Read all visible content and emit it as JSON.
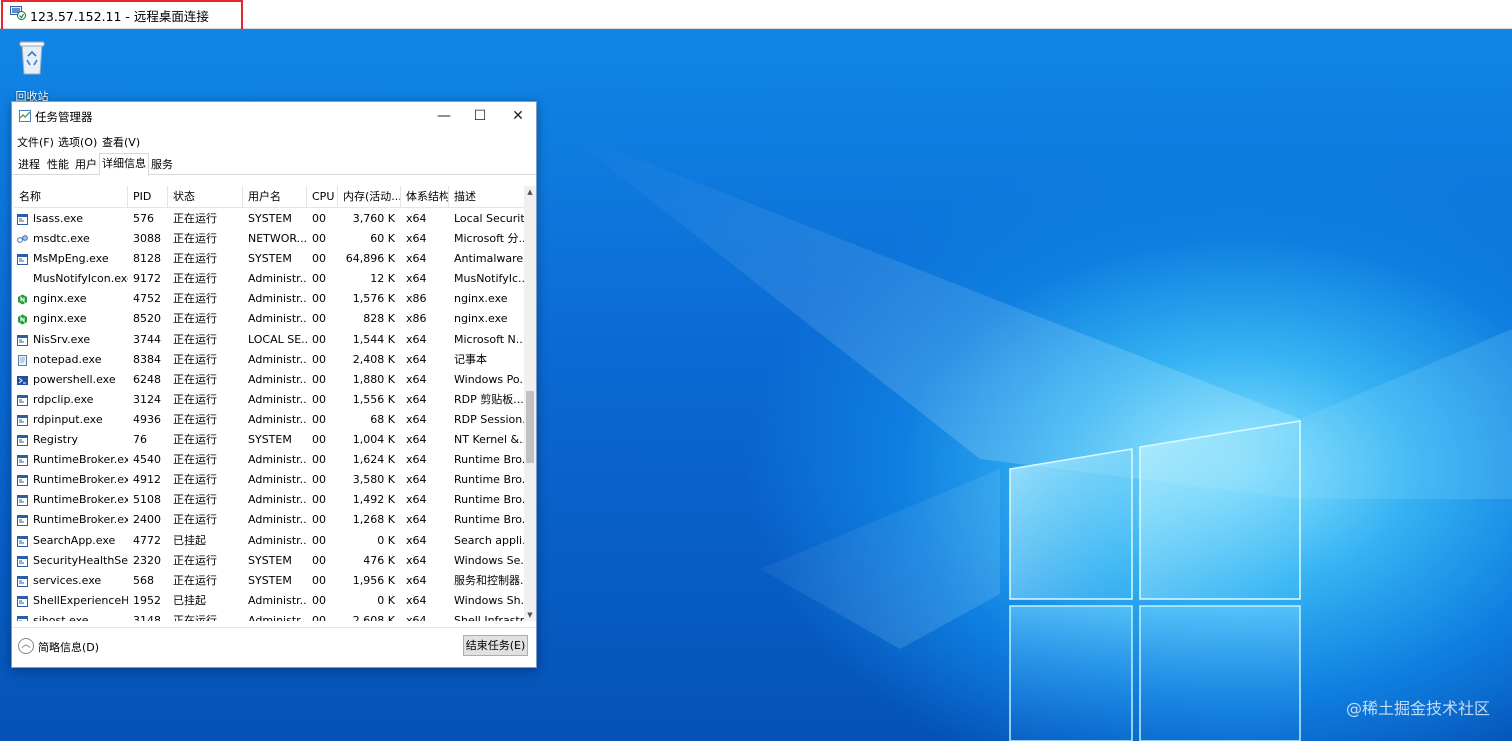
{
  "rdp": {
    "title": "123.57.152.11 - 远程桌面连接",
    "icon": "remote-desktop-icon",
    "highlight_color": "#e5262b"
  },
  "desktop": {
    "recycle_bin_label": "回收站",
    "watermark": "@稀土掘金技术社区",
    "background_color": "#0a5cc8"
  },
  "taskmgr": {
    "title": "任务管理器",
    "menu": [
      "文件(F)",
      "选项(O)",
      "查看(V)"
    ],
    "tabs": [
      "进程",
      "性能",
      "用户",
      "详细信息",
      "服务"
    ],
    "active_tab": "详细信息",
    "columns": [
      "名称",
      "PID",
      "状态",
      "用户名",
      "CPU",
      "内存(活动...",
      "体系结构",
      "描述"
    ],
    "rows": [
      {
        "name": "lsass.exe",
        "pid": "576",
        "status": "正在运行",
        "user": "SYSTEM",
        "cpu": "00",
        "mem": "3,760 K",
        "arch": "x64",
        "desc": "Local Securit...",
        "icon": "app-window-icon"
      },
      {
        "name": "msdtc.exe",
        "pid": "3088",
        "status": "正在运行",
        "user": "NETWOR...",
        "cpu": "00",
        "mem": "60 K",
        "arch": "x64",
        "desc": "Microsoft 分...",
        "icon": "network-icon"
      },
      {
        "name": "MsMpEng.exe",
        "pid": "8128",
        "status": "正在运行",
        "user": "SYSTEM",
        "cpu": "00",
        "mem": "64,896 K",
        "arch": "x64",
        "desc": "Antimalware...",
        "icon": "app-window-icon"
      },
      {
        "name": "MusNotifyIcon.exe",
        "pid": "9172",
        "status": "正在运行",
        "user": "Administr...",
        "cpu": "00",
        "mem": "12 K",
        "arch": "x64",
        "desc": "MusNotifyIc...",
        "icon": "blank-icon"
      },
      {
        "name": "nginx.exe",
        "pid": "4752",
        "status": "正在运行",
        "user": "Administr...",
        "cpu": "00",
        "mem": "1,576 K",
        "arch": "x86",
        "desc": "nginx.exe",
        "icon": "nginx-icon"
      },
      {
        "name": "nginx.exe",
        "pid": "8520",
        "status": "正在运行",
        "user": "Administr...",
        "cpu": "00",
        "mem": "828 K",
        "arch": "x86",
        "desc": "nginx.exe",
        "icon": "nginx-icon"
      },
      {
        "name": "NisSrv.exe",
        "pid": "3744",
        "status": "正在运行",
        "user": "LOCAL SE...",
        "cpu": "00",
        "mem": "1,544 K",
        "arch": "x64",
        "desc": "Microsoft N...",
        "icon": "app-window-icon"
      },
      {
        "name": "notepad.exe",
        "pid": "8384",
        "status": "正在运行",
        "user": "Administr...",
        "cpu": "00",
        "mem": "2,408 K",
        "arch": "x64",
        "desc": "记事本",
        "icon": "notepad-icon"
      },
      {
        "name": "powershell.exe",
        "pid": "6248",
        "status": "正在运行",
        "user": "Administr...",
        "cpu": "00",
        "mem": "1,880 K",
        "arch": "x64",
        "desc": "Windows Po...",
        "icon": "powershell-icon"
      },
      {
        "name": "rdpclip.exe",
        "pid": "3124",
        "status": "正在运行",
        "user": "Administr...",
        "cpu": "00",
        "mem": "1,556 K",
        "arch": "x64",
        "desc": "RDP 剪贴板...",
        "icon": "app-window-icon"
      },
      {
        "name": "rdpinput.exe",
        "pid": "4936",
        "status": "正在运行",
        "user": "Administr...",
        "cpu": "00",
        "mem": "68 K",
        "arch": "x64",
        "desc": "RDP Session...",
        "icon": "app-window-icon"
      },
      {
        "name": "Registry",
        "pid": "76",
        "status": "正在运行",
        "user": "SYSTEM",
        "cpu": "00",
        "mem": "1,004 K",
        "arch": "x64",
        "desc": "NT Kernel &...",
        "icon": "app-window-icon"
      },
      {
        "name": "RuntimeBroker.exe",
        "pid": "4540",
        "status": "正在运行",
        "user": "Administr...",
        "cpu": "00",
        "mem": "1,624 K",
        "arch": "x64",
        "desc": "Runtime Bro...",
        "icon": "app-window-icon"
      },
      {
        "name": "RuntimeBroker.exe",
        "pid": "4912",
        "status": "正在运行",
        "user": "Administr...",
        "cpu": "00",
        "mem": "3,580 K",
        "arch": "x64",
        "desc": "Runtime Bro...",
        "icon": "app-window-icon"
      },
      {
        "name": "RuntimeBroker.exe",
        "pid": "5108",
        "status": "正在运行",
        "user": "Administr...",
        "cpu": "00",
        "mem": "1,492 K",
        "arch": "x64",
        "desc": "Runtime Bro...",
        "icon": "app-window-icon"
      },
      {
        "name": "RuntimeBroker.exe",
        "pid": "2400",
        "status": "正在运行",
        "user": "Administr...",
        "cpu": "00",
        "mem": "1,268 K",
        "arch": "x64",
        "desc": "Runtime Bro...",
        "icon": "app-window-icon"
      },
      {
        "name": "SearchApp.exe",
        "pid": "4772",
        "status": "已挂起",
        "user": "Administr...",
        "cpu": "00",
        "mem": "0 K",
        "arch": "x64",
        "desc": "Search appli...",
        "icon": "app-window-icon"
      },
      {
        "name": "SecurityHealthServi...",
        "pid": "2320",
        "status": "正在运行",
        "user": "SYSTEM",
        "cpu": "00",
        "mem": "476 K",
        "arch": "x64",
        "desc": "Windows Se...",
        "icon": "app-window-icon"
      },
      {
        "name": "services.exe",
        "pid": "568",
        "status": "正在运行",
        "user": "SYSTEM",
        "cpu": "00",
        "mem": "1,956 K",
        "arch": "x64",
        "desc": "服务和控制器...",
        "icon": "app-window-icon"
      },
      {
        "name": "ShellExperienceHo...",
        "pid": "1952",
        "status": "已挂起",
        "user": "Administr...",
        "cpu": "00",
        "mem": "0 K",
        "arch": "x64",
        "desc": "Windows Sh...",
        "icon": "app-window-icon"
      },
      {
        "name": "sihost.exe",
        "pid": "3148",
        "status": "正在运行",
        "user": "Administr...",
        "cpu": "00",
        "mem": "2,608 K",
        "arch": "x64",
        "desc": "Shell Infrastr...",
        "icon": "app-window-icon"
      }
    ],
    "footer": {
      "less_details": "简略信息(D)",
      "end_task": "结束任务(E)"
    },
    "window_buttons": {
      "minimize": "—",
      "maximize": "☐",
      "close": "✕"
    }
  }
}
